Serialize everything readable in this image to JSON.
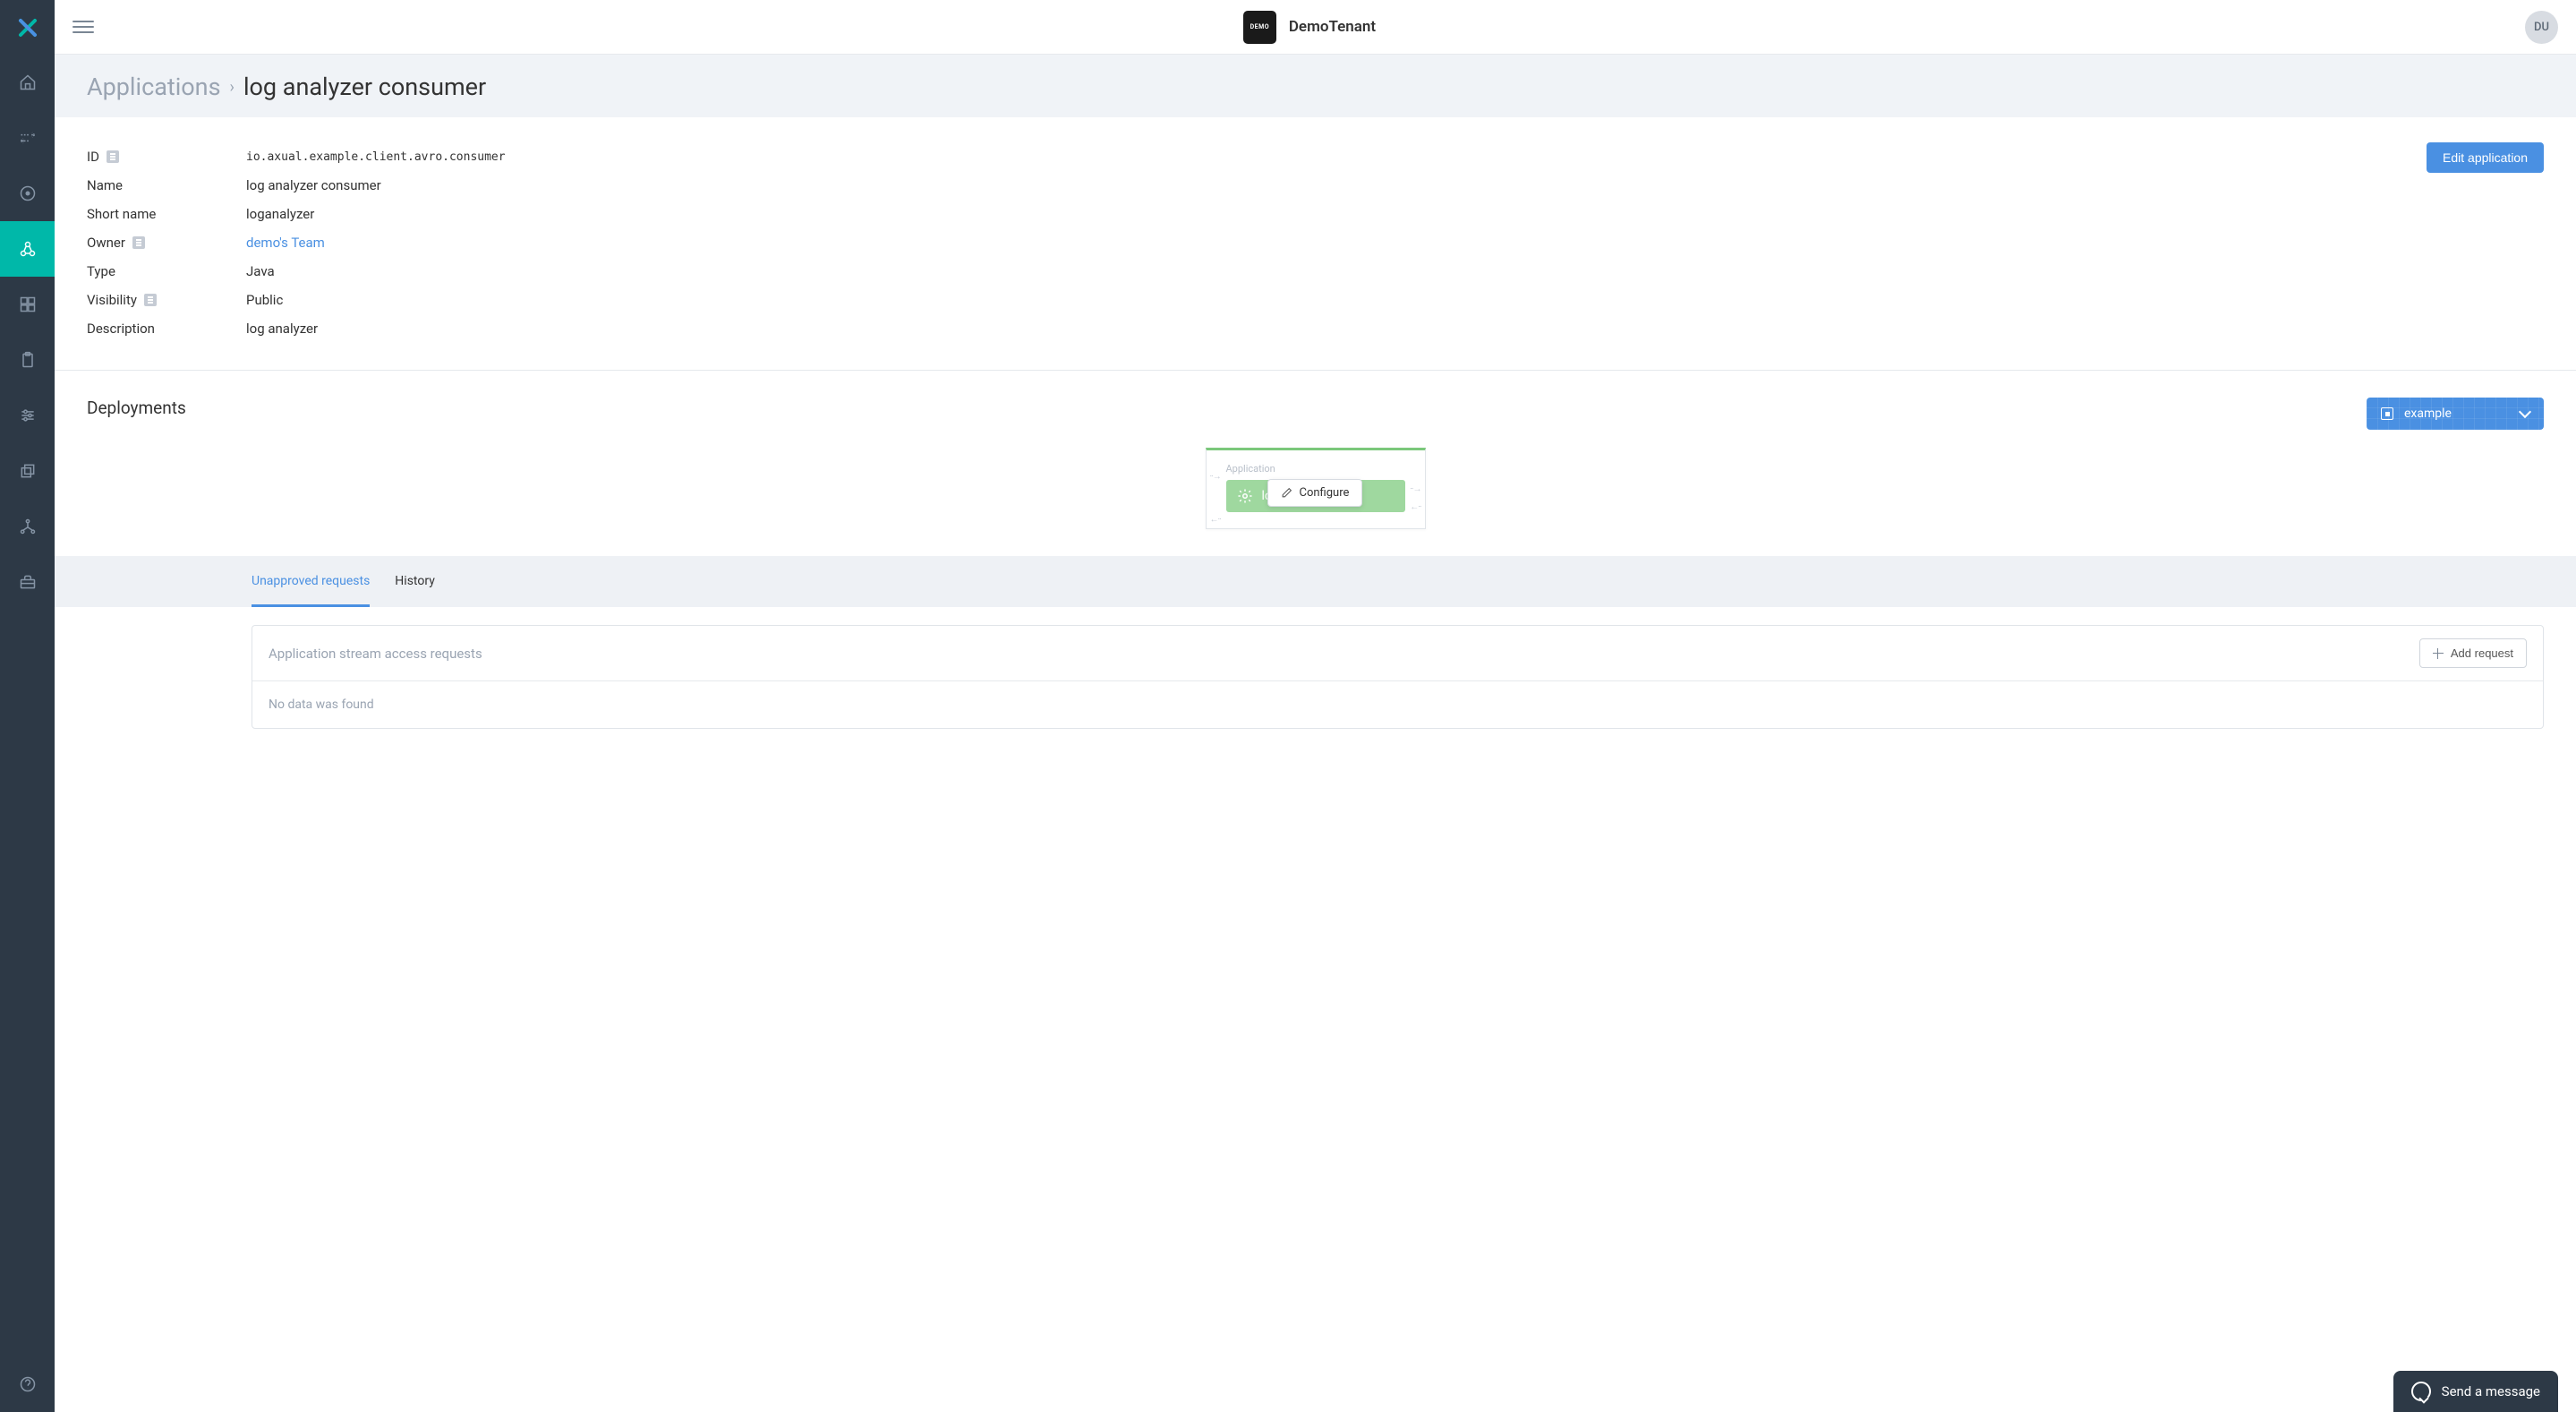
{
  "topbar": {
    "tenant_name": "DemoTenant",
    "tenant_badge": "DEMO",
    "avatar_initials": "DU"
  },
  "breadcrumb": {
    "root": "Applications",
    "current": "log analyzer consumer"
  },
  "details": {
    "labels": {
      "id": "ID",
      "name": "Name",
      "short_name": "Short name",
      "owner": "Owner",
      "type": "Type",
      "visibility": "Visibility",
      "description": "Description"
    },
    "values": {
      "id": "io.axual.example.client.avro.consumer",
      "name": "log analyzer consumer",
      "short_name": "loganalyzer",
      "owner": "demo's Team",
      "type": "Java",
      "visibility": "Public",
      "description": "log analyzer"
    },
    "edit_button": "Edit application"
  },
  "deployments": {
    "title": "Deployments",
    "env_selected": "example",
    "card": {
      "label": "Application",
      "app_name": "loganalyzer",
      "configure_label": "Configure"
    }
  },
  "tabs": {
    "unapproved": "Unapproved requests",
    "history": "History"
  },
  "requests": {
    "title": "Application stream access requests",
    "add_button": "Add request",
    "no_data": "No data was found"
  },
  "chat": {
    "label": "Send a message"
  }
}
